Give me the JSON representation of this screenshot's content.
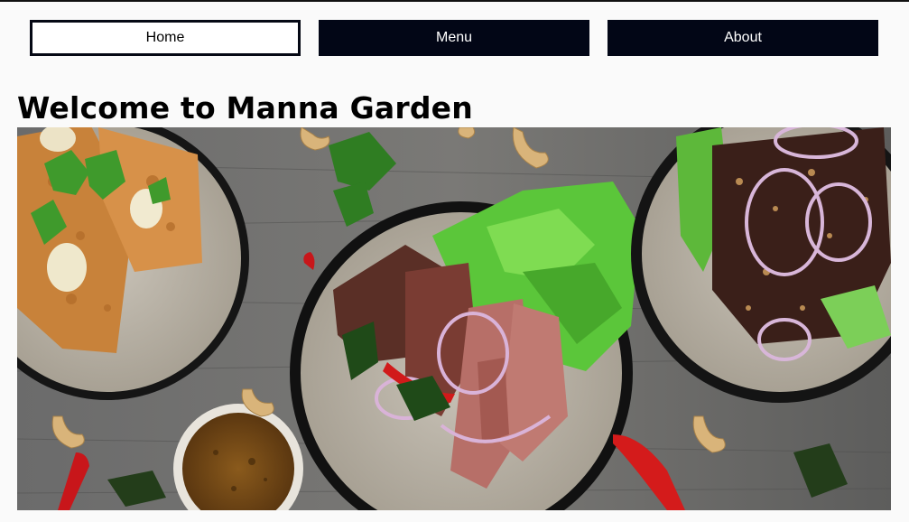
{
  "nav": {
    "items": [
      {
        "label": "Home",
        "active": true
      },
      {
        "label": "Menu",
        "active": false
      },
      {
        "label": "About",
        "active": false
      }
    ],
    "colors": {
      "active_bg": "#ffffff",
      "inactive_bg": "#020616",
      "inactive_text": "#ffffff"
    }
  },
  "main": {
    "title": "Welcome to Manna Garden",
    "hero_image": {
      "subject": "plates-of-grilled-steak-and-salad-on-wooden-table"
    }
  }
}
